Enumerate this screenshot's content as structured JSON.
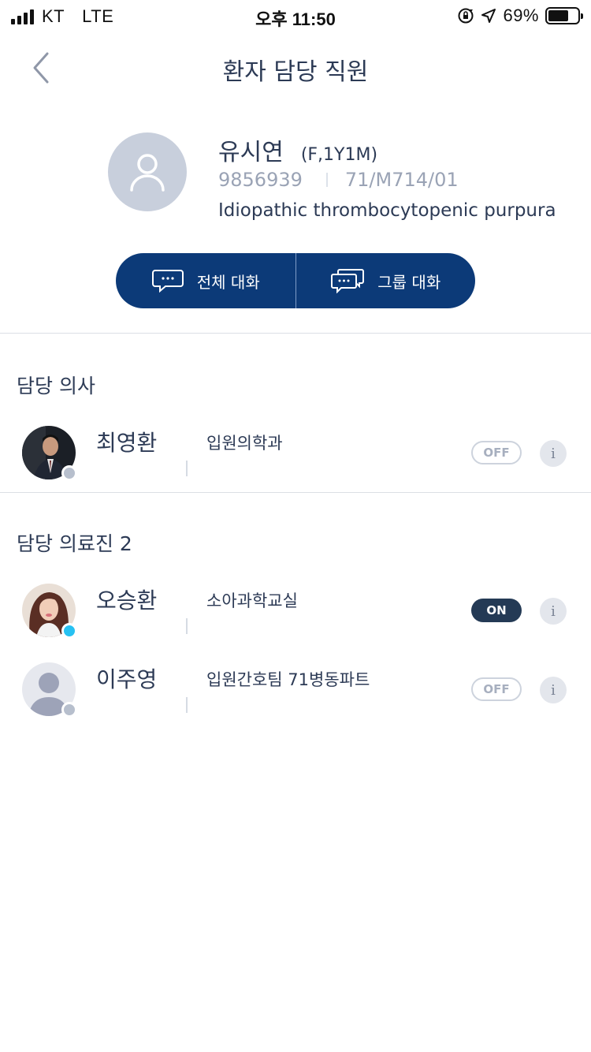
{
  "status_bar": {
    "carrier": "KT",
    "network": "LTE",
    "time": "오후 11:50",
    "battery": "69%",
    "battery_level": 0.69
  },
  "header": {
    "title": "환자 담당 직원"
  },
  "patient": {
    "name": "유시연",
    "meta": "(F,1Y1M)",
    "id": "9856939",
    "room": "71/M714/01",
    "diagnosis": "Idiopathic thrombocytopenic purpura"
  },
  "chat_buttons": {
    "all_chat": "전체 대화",
    "group_chat": "그룹 대화"
  },
  "doctor_section": {
    "title": "담당 의사",
    "staff": [
      {
        "name": "최영환",
        "dept": "입원의학과",
        "toggle": "OFF",
        "online": false
      }
    ]
  },
  "medical_section": {
    "title": "담당 의료진 2",
    "staff": [
      {
        "name": "오승환",
        "dept": "소아과학교실",
        "toggle": "ON",
        "online": true
      },
      {
        "name": "이주영",
        "dept": "입원간호팀 71병동파트",
        "toggle": "OFF",
        "online": false
      }
    ]
  },
  "colors": {
    "primary": "#0c3a78",
    "text": "#2c3a55",
    "online": "#27c1f2",
    "offline": "#b7bfcd"
  },
  "icons": {
    "back": "chevron-left-icon",
    "signal": "signal-bars-icon",
    "orientation_lock": "orientation-lock-icon",
    "location": "location-arrow-icon",
    "battery": "battery-icon",
    "chat": "chat-bubble-icon",
    "group_chat": "group-chat-icon",
    "info": "info-icon"
  }
}
